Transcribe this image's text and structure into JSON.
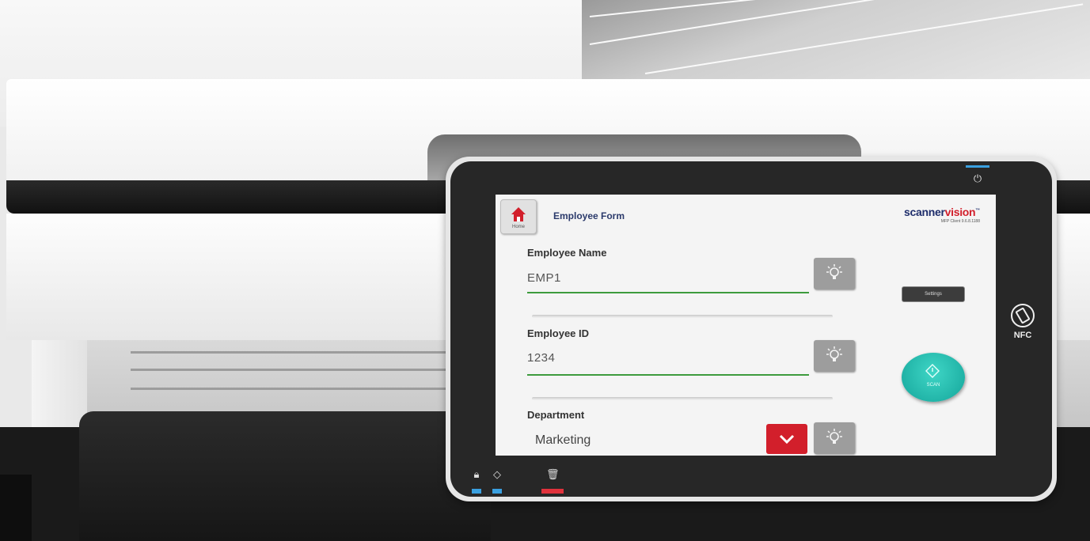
{
  "screen": {
    "home_label": "Home",
    "form_title": "Employee Form",
    "brand": {
      "name_main": "scanner",
      "name_accent": "vision",
      "tm": "™",
      "subtitle": "MFP Client 9.6.8.1188"
    },
    "fields": [
      {
        "label": "Employee Name",
        "value": "EMP1"
      },
      {
        "label": "Employee ID",
        "value": "1234"
      },
      {
        "label": "Department",
        "value": "Marketing"
      }
    ],
    "settings_label": "Settings",
    "scan_label": "SCAN"
  },
  "panel": {
    "nfc_label": "NFC"
  },
  "colors": {
    "accent_green": "#3d9b3d",
    "scan_teal": "#1fb7aa",
    "dropdown_red": "#d21f2b",
    "brand_navy": "#1e2d6b"
  }
}
